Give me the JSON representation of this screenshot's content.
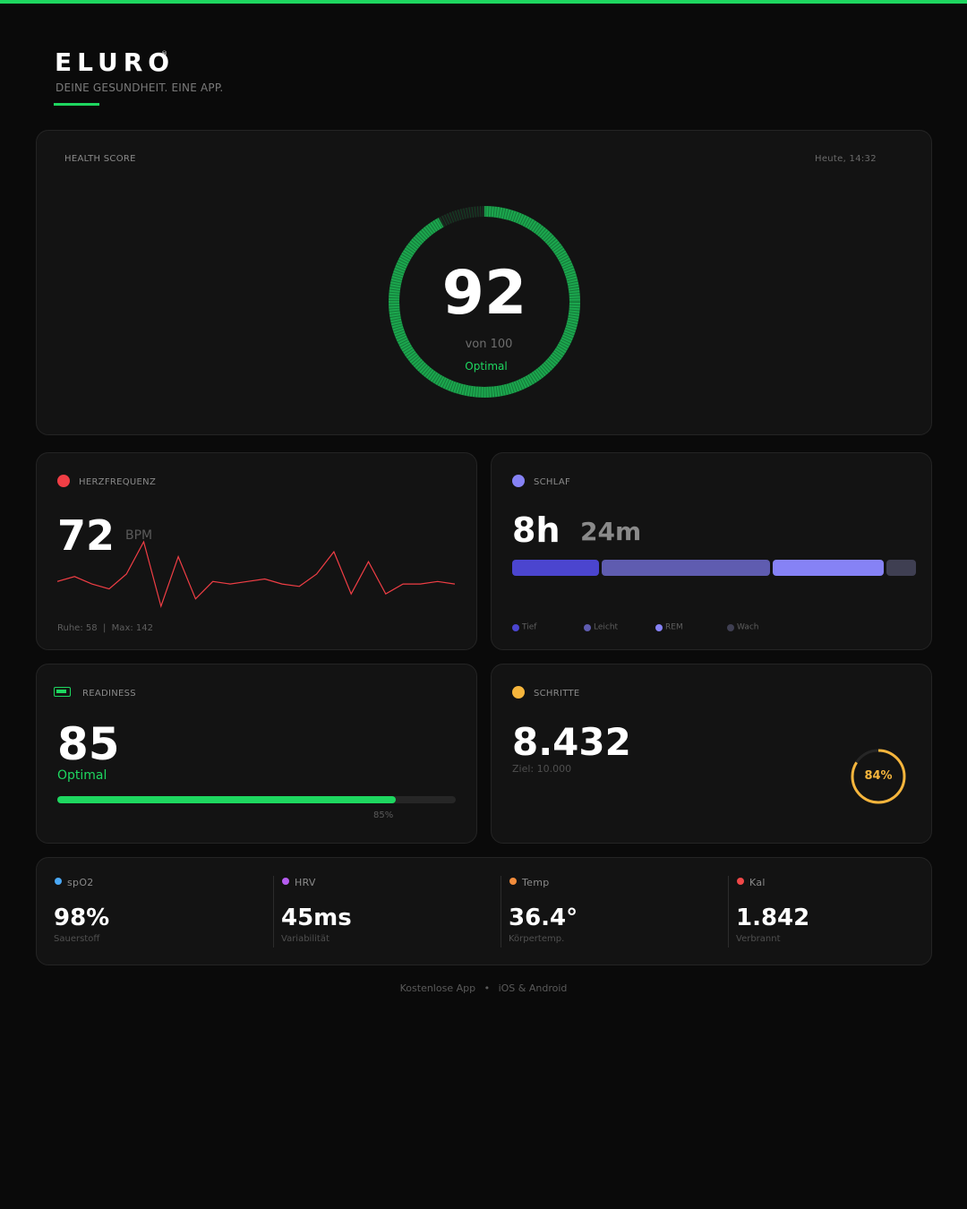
{
  "brand": {
    "name": "ELURO",
    "registered": "®",
    "tagline": "DEINE GESUNDHEIT. EINE APP."
  },
  "health_score": {
    "label": "HEALTH SCORE",
    "timestamp": "Heute, 14:32",
    "score": "92",
    "score_value": 92,
    "max_text": "von 100",
    "status": "Optimal",
    "color": "#1ed760"
  },
  "heart_rate": {
    "label": "HERZFREQUENZ",
    "value": "72",
    "unit": "BPM",
    "range_text": "Ruhe: 58  |  Max: 142",
    "color": "#f03e45",
    "sparkline": [
      72,
      74,
      71,
      69,
      75,
      88,
      62,
      82,
      65,
      72,
      71,
      72,
      73,
      71,
      70,
      75,
      84,
      67,
      80,
      67,
      71,
      71,
      72,
      71
    ]
  },
  "sleep": {
    "label": "SCHLAF",
    "hours": "8h",
    "minutes": "24m",
    "color": "#8682f5",
    "stages": [
      {
        "name": "Tief",
        "share": 0.22,
        "color": "#4b45cf"
      },
      {
        "name": "Leicht",
        "share": 0.42,
        "color": "#5f5cb0"
      },
      {
        "name": "REM",
        "share": 0.28,
        "color": "#8682f5"
      },
      {
        "name": "Wach",
        "share": 0.08,
        "color": "#3f3f52"
      }
    ]
  },
  "readiness": {
    "label": "READINESS",
    "value": "85",
    "status": "Optimal",
    "progress_text": "85%",
    "progress": 0.85,
    "color": "#1ed760"
  },
  "steps": {
    "label": "SCHRITTE",
    "value": "8.432",
    "goal_text": "Ziel: 10.000",
    "percent_text": "84%",
    "percent": 0.84,
    "color": "#f5b53c"
  },
  "metrics": [
    {
      "label": "spO2",
      "value": "98%",
      "caption": "Sauerstoff",
      "color": "#4aa8f5"
    },
    {
      "label": "HRV",
      "value": "45ms",
      "caption": "Variabilität",
      "color": "#b55cf0"
    },
    {
      "label": "Temp",
      "value": "36.4°",
      "caption": "Körpertemp.",
      "color": "#f28c3c"
    },
    {
      "label": "Kal",
      "value": "1.842",
      "caption": "Verbrannt",
      "color": "#f04848"
    }
  ],
  "footer": {
    "left": "Kostenlose App",
    "separator": "•",
    "right": "iOS & Android"
  }
}
